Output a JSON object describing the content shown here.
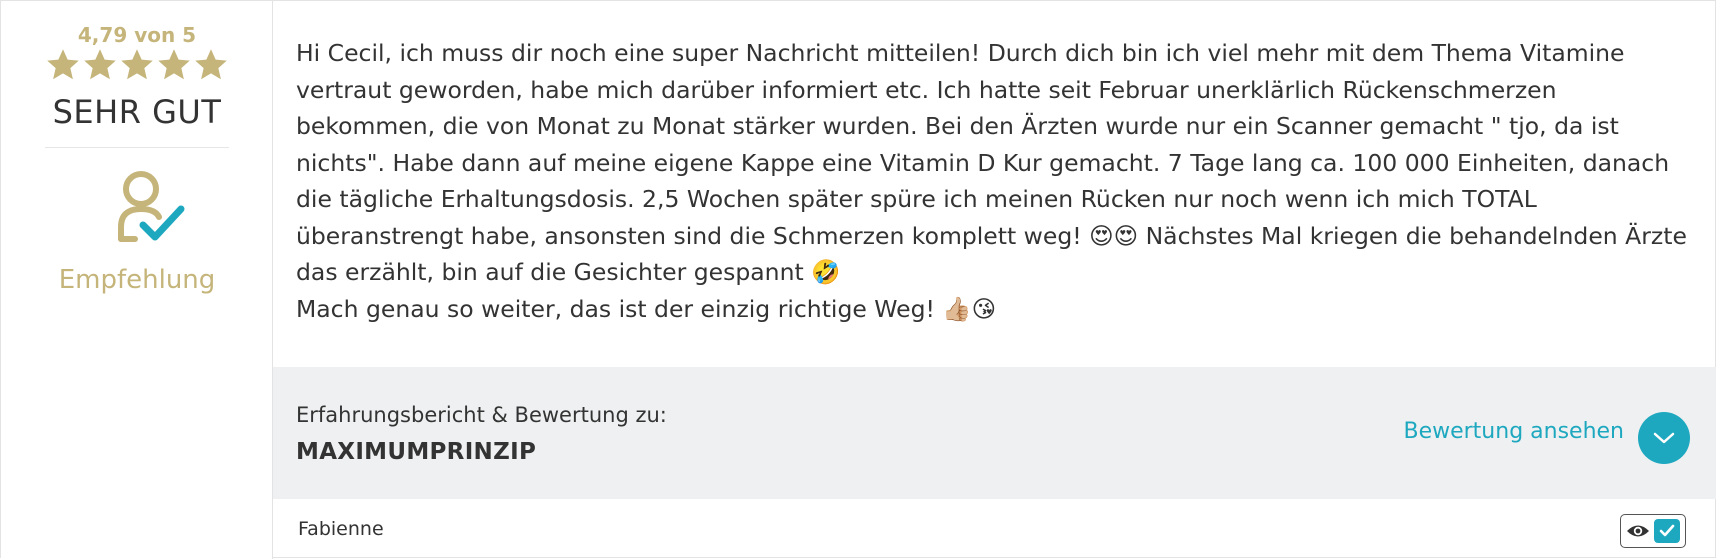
{
  "rating": {
    "score_text": "4,79 von 5",
    "stars": 4.79,
    "label": "SEHR GUT"
  },
  "recommendation": {
    "label": "Empfehlung"
  },
  "review": {
    "paragraphs": [
      "Hi Cecil, ich muss dir noch eine super Nachricht mitteilen! Durch dich bin ich viel mehr mit dem Thema Vitamine vertraut geworden, habe mich darüber informiert etc. Ich hatte seit Februar unerklärlich Rückenschmerzen bekommen, die von Monat zu Monat stärker wurden. Bei den Ärzten wurde nur ein Scanner gemacht \" tjo, da ist nichts\". Habe dann auf meine eigene Kappe eine Vitamin D Kur gemacht. 7 Tage lang ca. 100 000 Einheiten, danach die tägliche Erhaltungsdosis. 2,5 Wochen später spüre ich meinen Rücken nur noch wenn ich mich TOTAL überanstrengt habe, ansonsten sind die Schmerzen komplett weg! 😍😍 Nächstes Mal kriegen die behandelnden Ärzte das erzählt, bin auf die Gesichter gespannt 🤣",
      "Mach genau so weiter, das ist der einzig richtige Weg! 👍🏼😘"
    ]
  },
  "product": {
    "caption": "Erfahrungsbericht & Bewertung zu:",
    "name": "MAXIMUMPRINZIP",
    "view_link": "Bewertung ansehen"
  },
  "author": "Fabienne",
  "colors": {
    "gold": "#c5b57b",
    "accent": "#1ea8c0",
    "bar_bg": "#eef0f1"
  },
  "icons": {
    "star": "star-icon",
    "recommend": "user-check-icon",
    "expand": "chevron-down-icon",
    "verified_eye": "eye-icon",
    "verified_check": "checkmark-icon"
  }
}
